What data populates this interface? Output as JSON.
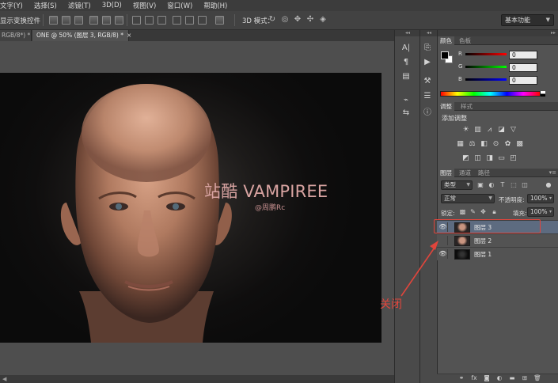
{
  "menu": {
    "items": [
      "文字(Y)",
      "选择(S)",
      "滤镜(T)",
      "3D(D)",
      "视图(V)",
      "窗口(W)",
      "帮助(H)"
    ]
  },
  "options_bar": {
    "transform_controls_label": "显示变换控件",
    "mode_3d_label": "3D 模式：",
    "workspace_value": "基本功能"
  },
  "document_tabs": [
    {
      "label": "RGB/8*) *",
      "close": "×",
      "active": false
    },
    {
      "label": "ONE @ 50% (图层 3, RGB/8) *",
      "close": "×",
      "active": true
    }
  ],
  "canvas": {
    "headline": "站酷 VAMPIREE",
    "credit": "@周鹏Rc"
  },
  "color_panel": {
    "tabs": [
      "颜色",
      "色板"
    ],
    "channels": [
      {
        "label": "R",
        "value": "0"
      },
      {
        "label": "G",
        "value": "0"
      },
      {
        "label": "B",
        "value": "0"
      }
    ]
  },
  "adjustments_panel": {
    "tabs": [
      "调整",
      "样式"
    ],
    "title": "添加调整"
  },
  "layers_panel": {
    "tabs": [
      "图层",
      "通道",
      "路径"
    ],
    "filter_kind": "类型",
    "blend_mode": "正常",
    "opacity_label": "不透明度:",
    "opacity_value": "100%",
    "lock_label": "锁定:",
    "fill_label": "填充:",
    "fill_value": "100%",
    "layers": [
      {
        "name": "图层 3",
        "visible": true,
        "selected": true
      },
      {
        "name": "图层 2",
        "visible": false,
        "selected": false
      },
      {
        "name": "图层 1",
        "visible": true,
        "selected": false
      }
    ]
  },
  "annotation": {
    "label": "关闭",
    "color": "#e0453c"
  },
  "colors": {
    "selected_layer": "#5d6b80",
    "headline": "#d8a3a1"
  }
}
